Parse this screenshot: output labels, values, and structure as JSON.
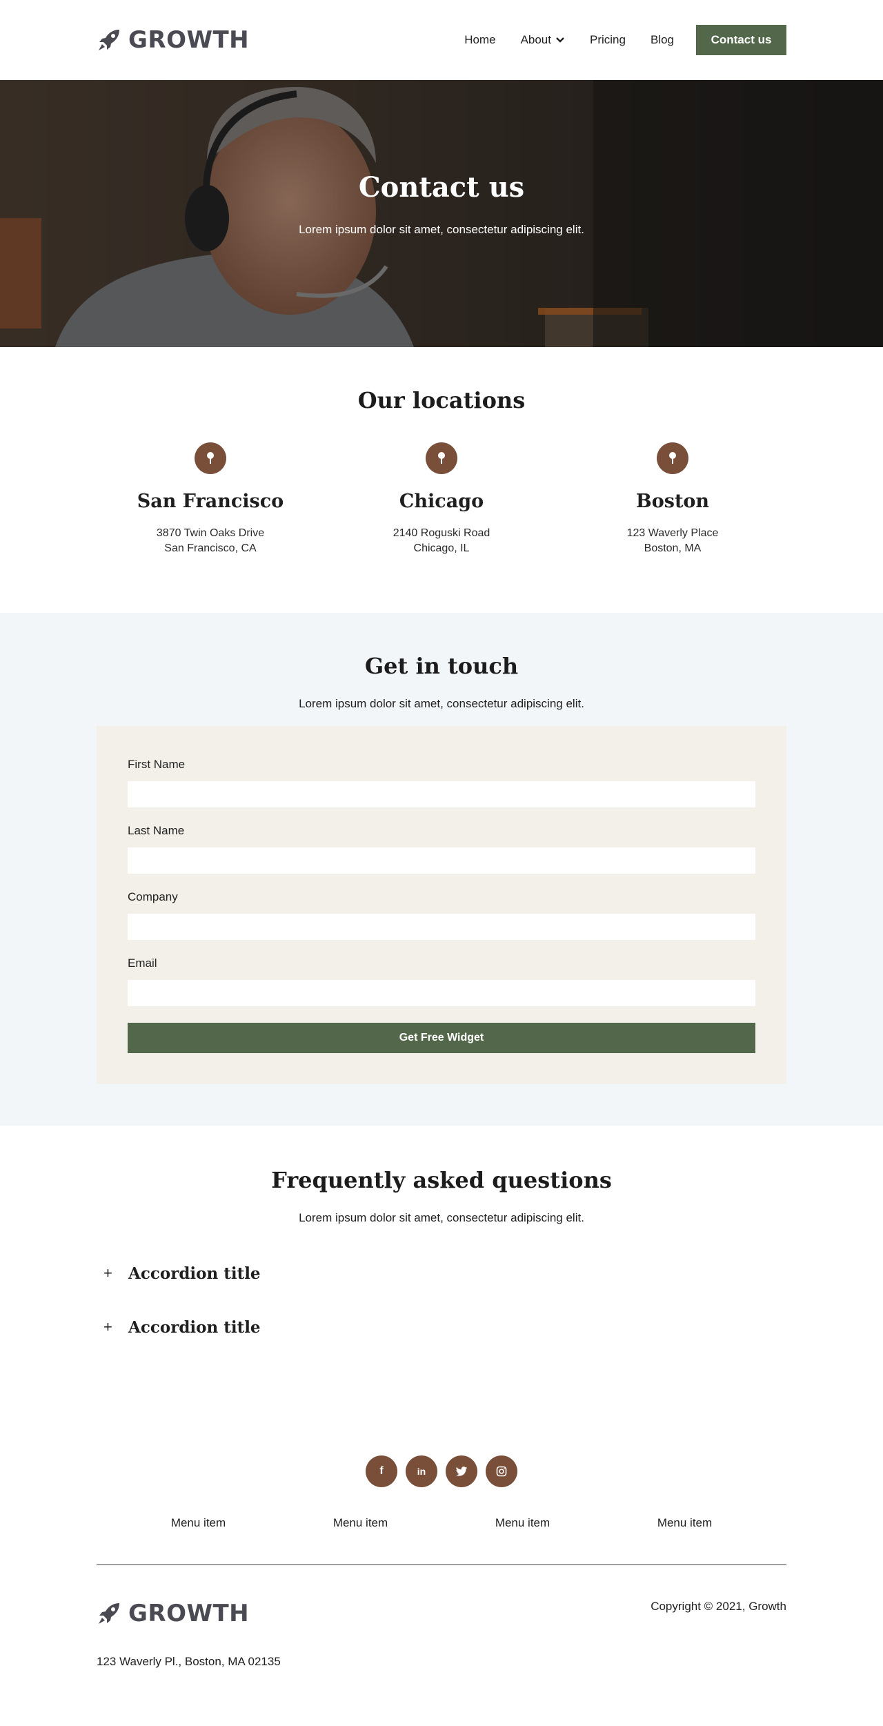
{
  "brand": {
    "name": "GROWTH"
  },
  "nav": {
    "links": [
      "Home",
      "About",
      "Pricing",
      "Blog"
    ],
    "cta": "Contact us"
  },
  "hero": {
    "title": "Contact us",
    "subtitle": "Lorem ipsum dolor sit amet, consectetur adipiscing elit."
  },
  "locations": {
    "title": "Our locations",
    "items": [
      {
        "city": "San Francisco",
        "line1": "3870 Twin Oaks Drive",
        "line2": "San Francisco, CA"
      },
      {
        "city": "Chicago",
        "line1": "2140 Roguski Road",
        "line2": "Chicago, IL"
      },
      {
        "city": "Boston",
        "line1": "123 Waverly Place",
        "line2": "Boston, MA"
      }
    ]
  },
  "touch": {
    "title": "Get in touch",
    "subtitle": "Lorem ipsum dolor sit amet, consectetur adipiscing elit.",
    "fields": [
      {
        "label": "First Name",
        "value": ""
      },
      {
        "label": "Last Name",
        "value": ""
      },
      {
        "label": "Company",
        "value": ""
      },
      {
        "label": "Email",
        "value": ""
      }
    ],
    "submit": "Get Free Widget"
  },
  "faq": {
    "title": "Frequently asked questions",
    "subtitle": "Lorem ipsum dolor sit amet, consectetur adipiscing elit.",
    "items": [
      {
        "icon": "+",
        "title": "Accordion title"
      },
      {
        "icon": "+",
        "title": "Accordion title"
      }
    ]
  },
  "footer": {
    "social": [
      {
        "icon": "facebook-icon",
        "glyph": "f"
      },
      {
        "icon": "linkedin-icon",
        "glyph": "in"
      },
      {
        "icon": "twitter-icon",
        "glyph": ""
      },
      {
        "icon": "instagram-icon",
        "glyph": ""
      }
    ],
    "menu": [
      "Menu item",
      "Menu item",
      "Menu item",
      "Menu item"
    ],
    "copyright": "Copyright © 2021, Growth",
    "address": "123 Waverly Pl., Boston, MA 02135"
  },
  "colors": {
    "accent_green": "#53684a",
    "accent_brown": "#7a4f3a",
    "touch_bg": "#f2f6f9",
    "form_bg": "#f3f0ea",
    "logo_gray": "#4a4a52"
  }
}
